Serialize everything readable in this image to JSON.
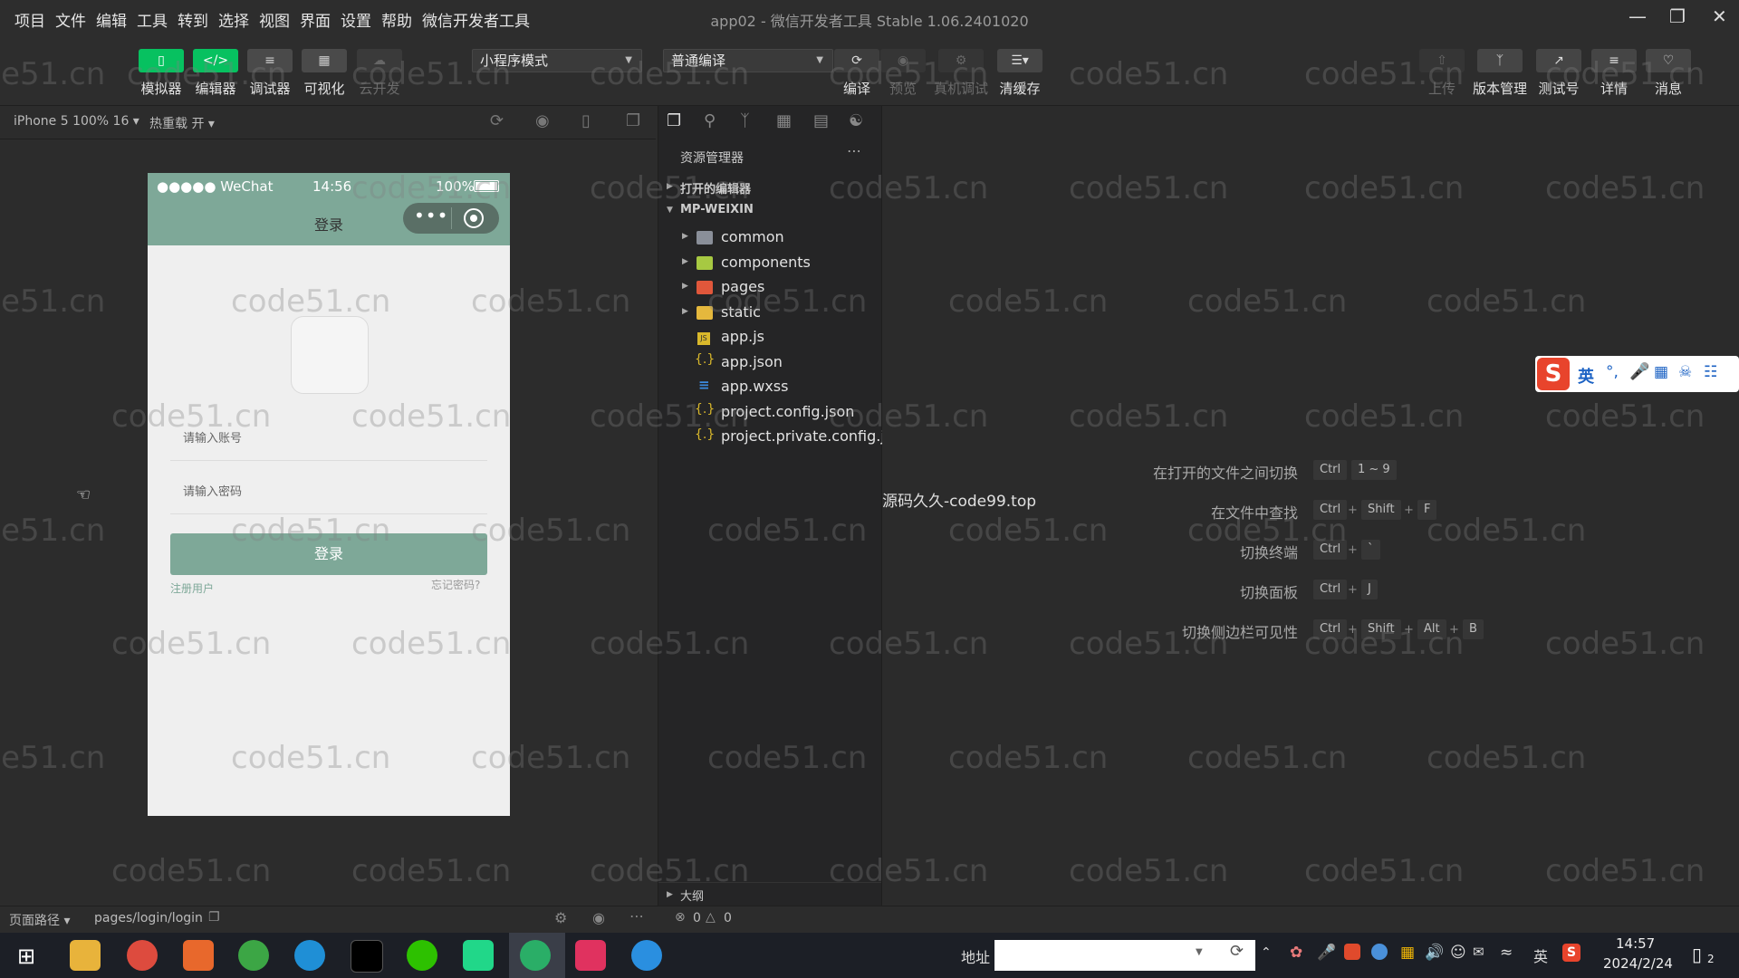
{
  "menubar": {
    "items": [
      "项目",
      "文件",
      "编辑",
      "工具",
      "转到",
      "选择",
      "视图",
      "界面",
      "设置",
      "帮助",
      "微信开发者工具"
    ],
    "title": "app02 - 微信开发者工具 Stable 1.06.2401020"
  },
  "toolbar": {
    "left": [
      {
        "label": "模拟器",
        "icon": "phone-icon",
        "accent": "#07c160"
      },
      {
        "label": "编辑器",
        "icon": "code-icon",
        "accent": "#07c160"
      },
      {
        "label": "调试器",
        "icon": "debug-icon",
        "accent": "#4a4a4a"
      },
      {
        "label": "可视化",
        "icon": "layout-icon",
        "accent": "#4a4a4a"
      },
      {
        "label": "云开发",
        "icon": "cloud-icon",
        "accent": "#3a3a3a"
      }
    ],
    "mode_dropdown": "小程序模式",
    "compile_dropdown": "普通编译",
    "middle": [
      {
        "label": "编译",
        "icon": "refresh-icon"
      },
      {
        "label": "预览",
        "icon": "eye-icon"
      },
      {
        "label": "真机调试",
        "icon": "bug-icon"
      },
      {
        "label": "清缓存",
        "icon": "layers-icon"
      }
    ],
    "right": [
      {
        "label": "上传",
        "icon": "upload-icon"
      },
      {
        "label": "版本管理",
        "icon": "branch-icon"
      },
      {
        "label": "测试号",
        "icon": "external-icon"
      },
      {
        "label": "详情",
        "icon": "menu-icon"
      },
      {
        "label": "消息",
        "icon": "bell-icon"
      }
    ]
  },
  "simulator": {
    "device": "iPhone 5 100% 16 ▾",
    "hot_reload": "热重载 开 ▾",
    "status_carrier": "●●●●● WeChat",
    "status_time": "14:56",
    "status_battery": "100%",
    "nav_title": "登录",
    "account_placeholder": "请输入账号",
    "password_placeholder": "请输入密码",
    "login_button": "登录",
    "register_link": "注册用户",
    "forgot_link": "忘记密码?"
  },
  "explorer": {
    "title": "资源管理器",
    "open_editors": "打开的编辑器",
    "root": "MP-WEIXIN",
    "items": [
      {
        "name": "common",
        "type": "folder",
        "color": "#8a8f99"
      },
      {
        "name": "components",
        "type": "folder",
        "color": "#a7c942"
      },
      {
        "name": "pages",
        "type": "folder",
        "color": "#e0573b"
      },
      {
        "name": "static",
        "type": "folder",
        "color": "#e5b83d"
      },
      {
        "name": "app.js",
        "type": "js"
      },
      {
        "name": "app.json",
        "type": "json"
      },
      {
        "name": "app.wxss",
        "type": "css"
      },
      {
        "name": "project.config.json",
        "type": "json"
      },
      {
        "name": "project.private.config.js...",
        "type": "json"
      }
    ],
    "outline": "大纲",
    "errors": "0",
    "warnings": "0"
  },
  "editor": {
    "banner": "源码久久-code99.top",
    "shortcuts": [
      {
        "label": "在打开的文件之间切换",
        "keys": [
          "Ctrl",
          "1 ~ 9"
        ]
      },
      {
        "label": "在文件中查找",
        "keys": [
          "Ctrl",
          "Shift",
          "F"
        ]
      },
      {
        "label": "切换终端",
        "keys": [
          "Ctrl",
          "`"
        ]
      },
      {
        "label": "切换面板",
        "keys": [
          "Ctrl",
          "J"
        ]
      },
      {
        "label": "切换侧边栏可见性",
        "keys": [
          "Ctrl",
          "Shift",
          "Alt",
          "B"
        ]
      }
    ]
  },
  "statusbar": {
    "page_path_label": "页面路径 ▾",
    "page_path": "pages/login/login"
  },
  "watermark": "code51.cn",
  "taskbar": {
    "address_label": "地址",
    "ime_lang": "英",
    "time": "14:57",
    "date": "2024/2/24",
    "notifications": "2"
  },
  "ime_toolbar": {
    "lang": "英"
  }
}
